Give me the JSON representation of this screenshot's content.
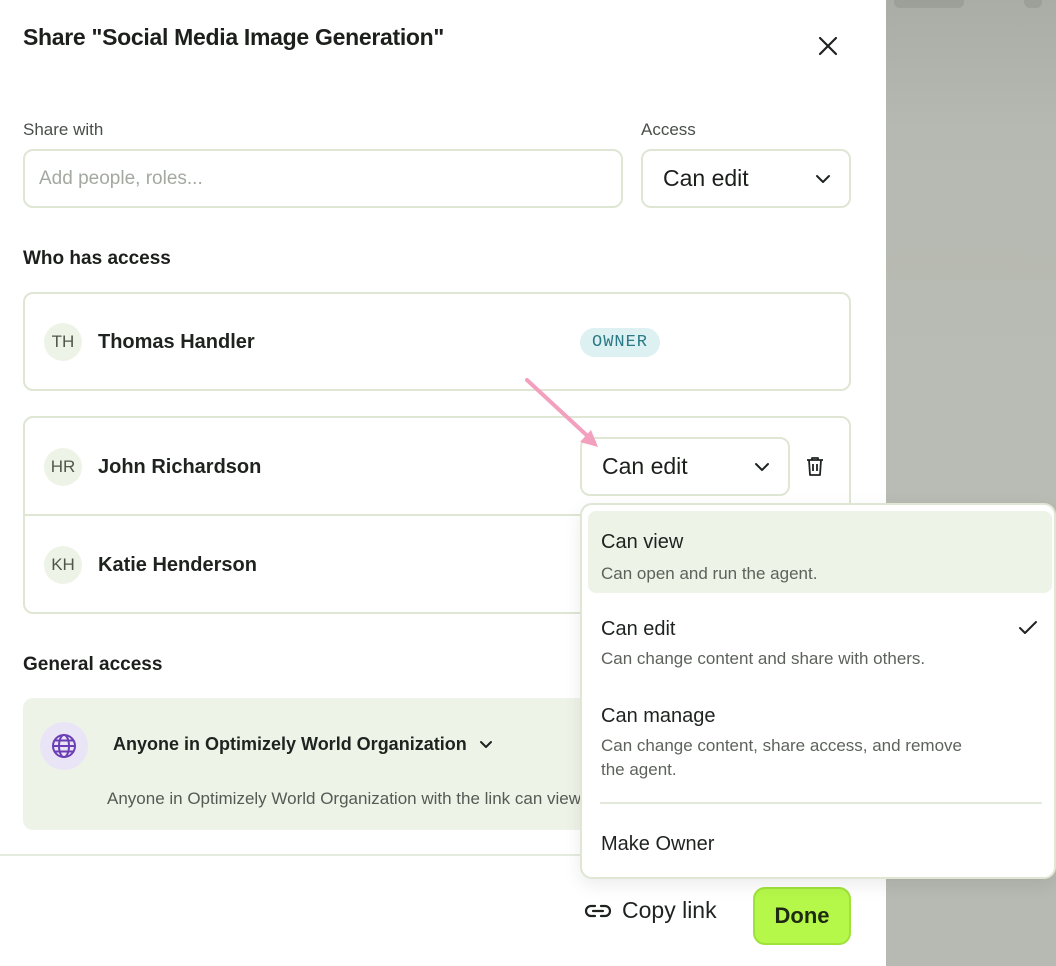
{
  "dialog": {
    "title": "Share \"Social Media Image Generation\"",
    "share_with_label": "Share with",
    "share_input_placeholder": "Add people, roles...",
    "access_label": "Access",
    "access_value": "Can edit"
  },
  "who_has_access": {
    "heading": "Who has access",
    "owner": {
      "initials": "TH",
      "name": "Thomas Handler",
      "badge": "OWNER"
    },
    "members": [
      {
        "initials": "HR",
        "name": "John Richardson",
        "role": "Can edit"
      },
      {
        "initials": "KH",
        "name": "Katie Henderson"
      }
    ]
  },
  "general_access": {
    "heading": "General access",
    "scope": "Anyone in Optimizely World Organization",
    "description": "Anyone in Optimizely World Organization with the link can view"
  },
  "role_menu": {
    "options": [
      {
        "title": "Can view",
        "description": "Can open and run the agent.",
        "highlighted": true,
        "selected": false
      },
      {
        "title": "Can edit",
        "description": "Can change content and share with others.",
        "highlighted": false,
        "selected": true
      },
      {
        "title": "Can manage",
        "description": "Can change content, share access, and remove the agent.",
        "highlighted": false,
        "selected": false
      }
    ],
    "make_owner": "Make Owner"
  },
  "footer": {
    "copy_link": "Copy link",
    "done": "Done"
  },
  "colors": {
    "done_bg": "#b5f84a",
    "owner_badge_bg": "#ddf0f2",
    "owner_badge_text": "#2b7a86",
    "arrow": "#f2a0be",
    "globe": "#6b3fb3"
  }
}
